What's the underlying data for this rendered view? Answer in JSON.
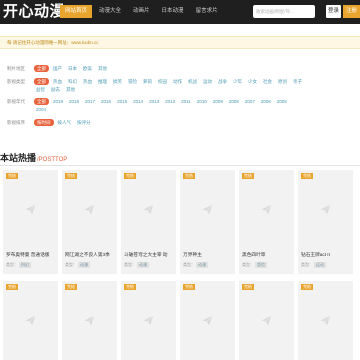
{
  "header": {
    "logo": "开心动漫",
    "nav": [
      "网站首页",
      "动漫大全",
      "动画片",
      "日本动漫",
      "留言求片"
    ],
    "search_placeholder": "收索动画/明星/导...",
    "login": "登录",
    "register": "注册"
  },
  "notice": "每 请记住开心动漫网唯一网址：www.kxdm.cc",
  "filters": {
    "region": {
      "label": "制片地区",
      "options": [
        "全部",
        "国产",
        "日本",
        "欧美",
        "其他"
      ]
    },
    "type": {
      "label": "影视类型",
      "options": [
        "全部",
        "热血",
        "科幻",
        "热血",
        "推理",
        "搞笑",
        "冒险",
        "萝莉",
        "校园",
        "动作",
        "机战",
        "运动",
        "战争",
        "少年",
        "少女",
        "社会",
        "原创",
        "亲子",
        "益智",
        "励志",
        "其他"
      ]
    },
    "year": {
      "label": "影视年代",
      "options": [
        "全部",
        "2019",
        "2018",
        "2017",
        "2016",
        "2015",
        "2014",
        "2013",
        "2012",
        "2011",
        "2010",
        "2009",
        "2008",
        "2007",
        "2006",
        "2005",
        "2004"
      ]
    },
    "sort": {
      "label": "影视排序",
      "options": [
        "按时间",
        "按人气",
        "按评分"
      ]
    }
  },
  "section": {
    "title": "本站热播",
    "subtitle": "/POSTTOP"
  },
  "cards": [
    {
      "badge": "完结",
      "title": "罗布奥特曼 普通话版",
      "type_label": "类型：",
      "genre": "科幻"
    },
    {
      "badge": "完结",
      "title": "网江湖之不良人第3季",
      "type_label": "类型：",
      "genre": "动漫"
    },
    {
      "badge": "完结",
      "title": "斗破苍穹之大主宰 动",
      "type_label": "类型：",
      "genre": "动漫"
    },
    {
      "badge": "完结",
      "title": "万界神主",
      "type_label": "类型：",
      "genre": "动漫"
    },
    {
      "badge": "完结",
      "title": "黑色四叶草",
      "type_label": "类型：",
      "genre": "冒险"
    },
    {
      "badge": "完结",
      "title": "钻石王牌act II",
      "type_label": "类型：",
      "genre": "运动"
    },
    {
      "badge": "完结",
      "title": "",
      "type_label": "",
      "genre": ""
    },
    {
      "badge": "完结",
      "title": "",
      "type_label": "",
      "genre": ""
    },
    {
      "badge": "完结",
      "title": "",
      "type_label": "",
      "genre": ""
    },
    {
      "badge": "完结",
      "title": "",
      "type_label": "",
      "genre": ""
    },
    {
      "badge": "完结",
      "title": "",
      "type_label": "",
      "genre": ""
    },
    {
      "badge": "完结",
      "title": "",
      "type_label": "",
      "genre": ""
    }
  ],
  "colors": {
    "accent": "#e8a42d",
    "tag_active": "#e8623c",
    "topbar": "#1f1f1f"
  }
}
